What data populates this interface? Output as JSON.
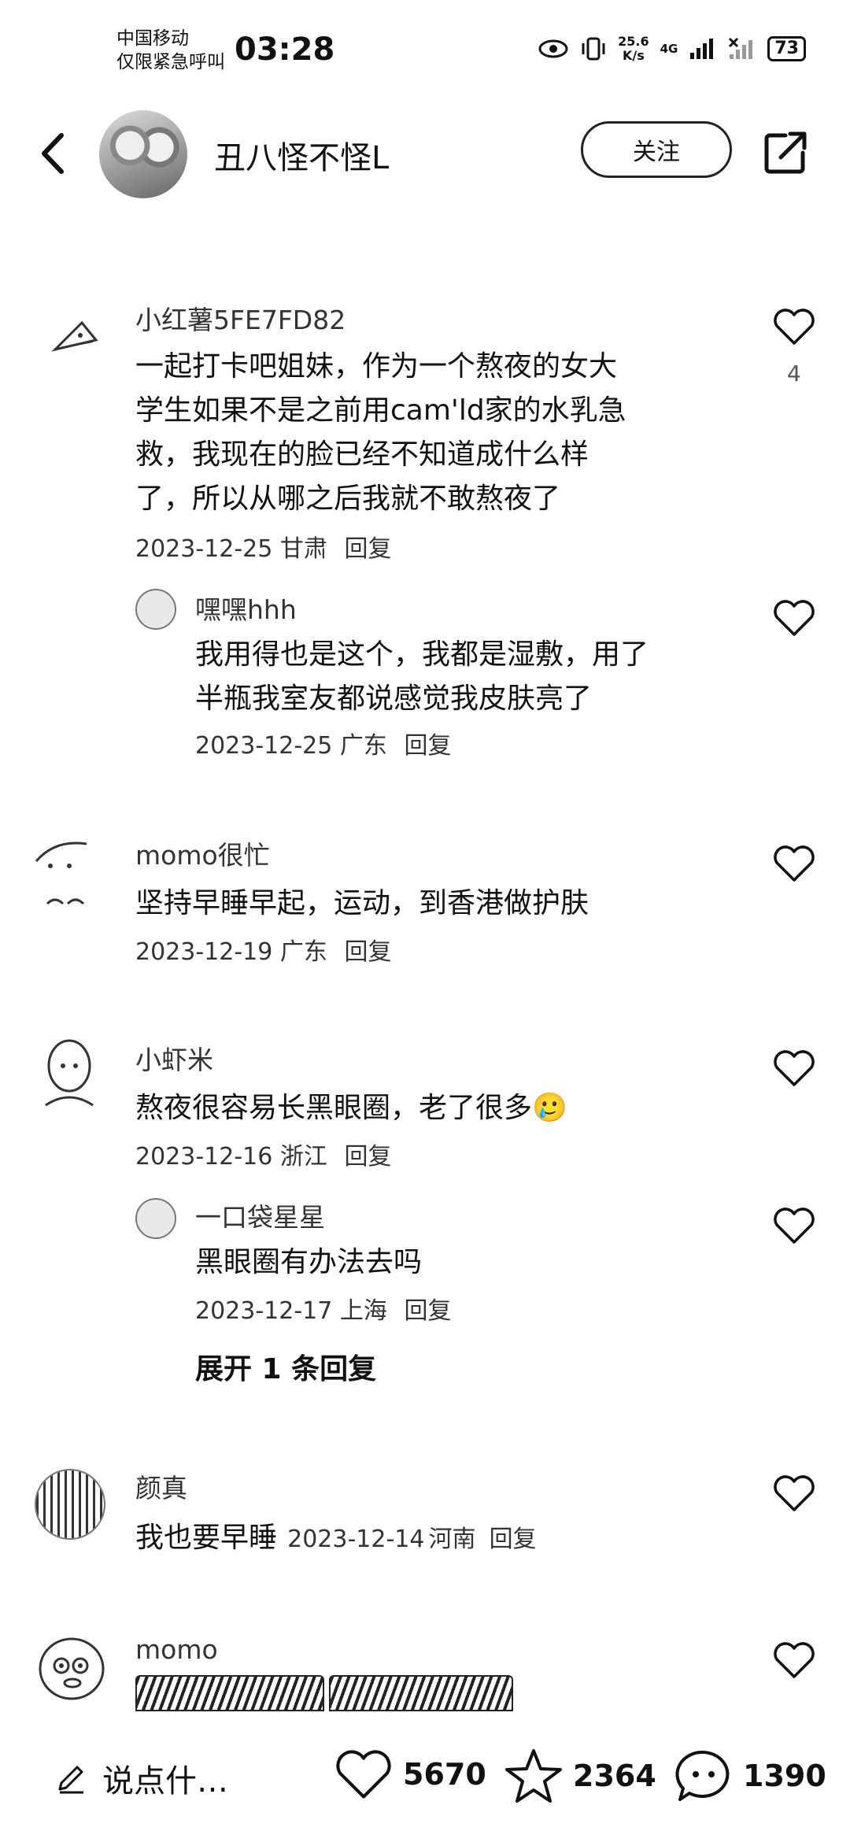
{
  "status_bar": {
    "carrier_line1": "中国移动",
    "carrier_line2": "仅限紧急呼叫",
    "time": "03:28",
    "speed_value": "25.6",
    "speed_unit": "K/s",
    "network": "4G",
    "battery": "73"
  },
  "header": {
    "title": "丑八怪不怪L",
    "follow_label": "关注"
  },
  "comments": [
    {
      "name": "小红薯5FE7FD82",
      "lines": [
        "一起打卡吧姐妹，作为一个熬夜的女大",
        "学生如果不是之前用cam'ld家的水乳急",
        "救，我现在的脸已经不知道成什么样",
        "了，所以从哪之后我就不敢熬夜了"
      ],
      "date": "2023-12-25",
      "location": "甘肃",
      "reply": "回复",
      "likes": "4"
    },
    {
      "name": "嘿嘿hhh",
      "lines": [
        "我用得也是这个，我都是湿敷，用了",
        "半瓶我室友都说感觉我皮肤亮了"
      ],
      "date": "2023-12-25",
      "location": "广东",
      "reply": "回复"
    },
    {
      "name": "momo很忙",
      "lines": [
        "坚持早睡早起，运动，到香港做护肤"
      ],
      "date": "2023-12-19",
      "location": "广东",
      "reply": "回复"
    },
    {
      "name": "小虾米",
      "lines": [
        "熬夜很容易长黑眼圈，老了很多🥲"
      ],
      "date": "2023-12-16",
      "location": "浙江",
      "reply": "回复"
    },
    {
      "name": "一口袋星星",
      "lines": [
        "黑眼圈有办法去吗"
      ],
      "date": "2023-12-17",
      "location": "上海",
      "reply": "回复"
    },
    {
      "name": "颜真",
      "text": "我也要早睡",
      "date": "2023-12-14",
      "location": "河南",
      "reply": "回复"
    },
    {
      "name": "momo"
    }
  ],
  "expand_replies": "展开 1 条回复",
  "bottom_bar": {
    "input_placeholder": "说点什…",
    "likes": "5670",
    "stars": "2364",
    "comments": "1390"
  }
}
